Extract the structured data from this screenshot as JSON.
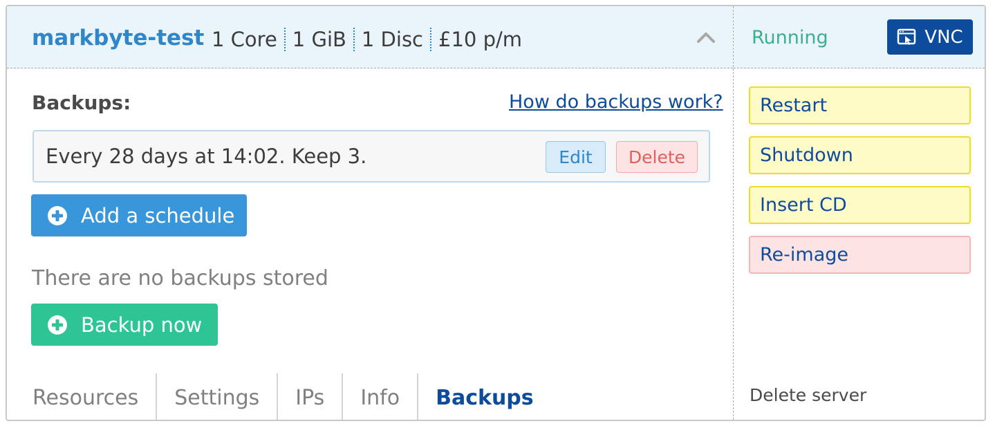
{
  "server": {
    "name": "markbyte-test",
    "specs": [
      "1 Core",
      "1 GiB",
      "1 Disc",
      "£10 p/m"
    ],
    "status": "Running",
    "vnc_label": "VNC"
  },
  "backups": {
    "heading": "Backups:",
    "help_link": "How do backups work?",
    "schedule_text": "Every 28 days at 14:02. Keep 3.",
    "edit_label": "Edit",
    "delete_label": "Delete",
    "add_schedule_label": "Add a schedule",
    "empty_text": "There are no backups stored",
    "backup_now_label": "Backup now"
  },
  "tabs": [
    {
      "label": "Resources",
      "active": false
    },
    {
      "label": "Settings",
      "active": false
    },
    {
      "label": "IPs",
      "active": false
    },
    {
      "label": "Info",
      "active": false
    },
    {
      "label": "Backups",
      "active": true
    }
  ],
  "actions": [
    {
      "label": "Restart",
      "style": "yellow"
    },
    {
      "label": "Shutdown",
      "style": "yellow"
    },
    {
      "label": "Insert CD",
      "style": "yellow"
    },
    {
      "label": "Re-image",
      "style": "red"
    }
  ],
  "delete_server_label": "Delete server",
  "icons": {
    "collapse": "chevron-up-icon",
    "vnc": "window-cursor-icon",
    "add": "plus-circle-icon"
  },
  "colors": {
    "brand_blue": "#2f86c9",
    "dark_blue": "#0d4c9c",
    "running_green": "#3cb08b",
    "backup_green": "#2ec494",
    "header_bg": "#eaf4fb"
  }
}
